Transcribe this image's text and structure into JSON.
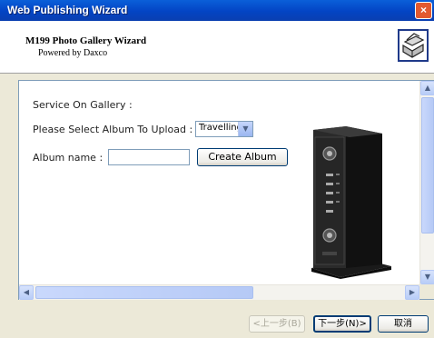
{
  "window": {
    "title": "Web Publishing Wizard",
    "close_glyph": "×"
  },
  "header": {
    "title": "M199 Photo Gallery Wizard",
    "subtitle": "Powered by Daxco",
    "icon": "printer-icon"
  },
  "form": {
    "service_label": "Service On Gallery :",
    "album_select_label": "Please Select Album To Upload :",
    "album_select_value": "Travelling",
    "album_name_label": "Album name :",
    "album_name_value": "",
    "create_album_label": "Create Album"
  },
  "device_image": "media-player-device-image",
  "footer": {
    "back_label": "<上一步(B)",
    "next_label": "下一步(N)>",
    "cancel_label": "取消"
  }
}
